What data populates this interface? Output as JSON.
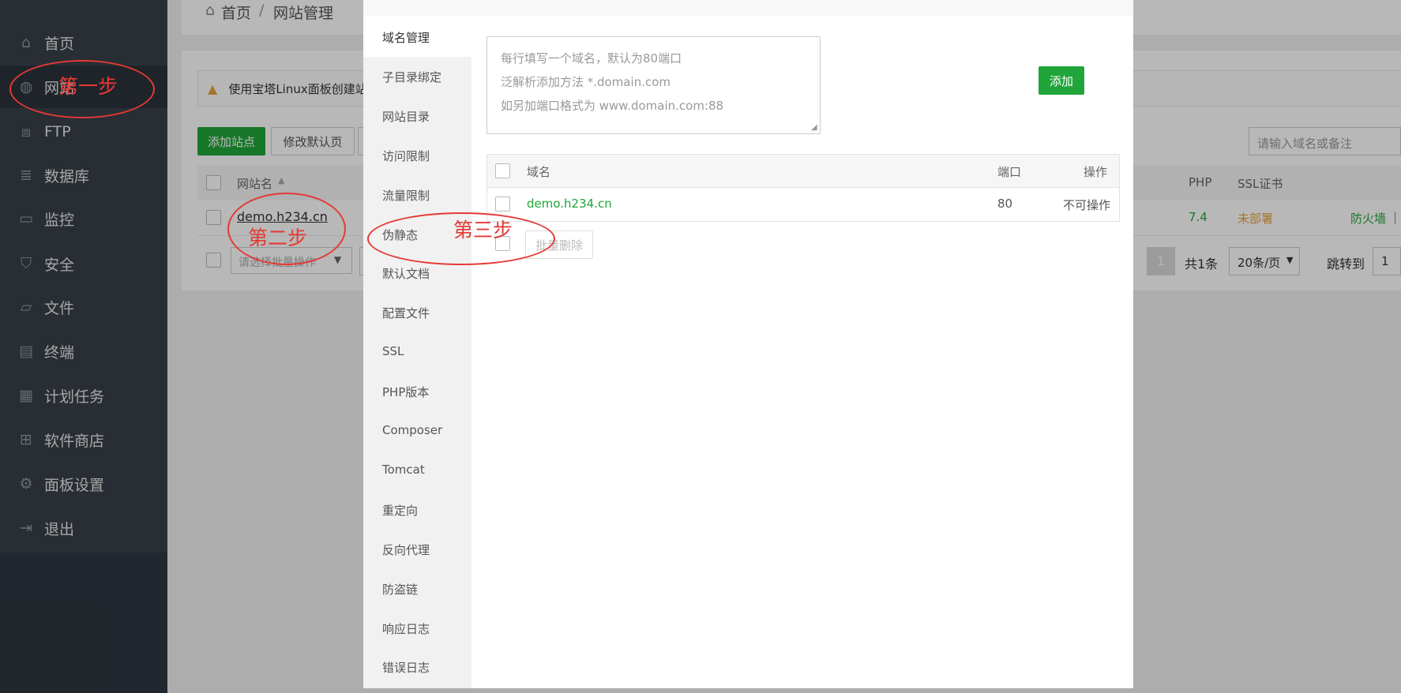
{
  "sidebar": {
    "items": [
      {
        "label": "首页",
        "icon": "home-icon"
      },
      {
        "label": "网站",
        "icon": "globe-icon"
      },
      {
        "label": "FTP",
        "icon": "ftp-icon"
      },
      {
        "label": "数据库",
        "icon": "database-icon"
      },
      {
        "label": "监控",
        "icon": "monitor-icon"
      },
      {
        "label": "安全",
        "icon": "shield-icon"
      },
      {
        "label": "文件",
        "icon": "folder-icon"
      },
      {
        "label": "终端",
        "icon": "terminal-icon"
      },
      {
        "label": "计划任务",
        "icon": "calendar-icon"
      },
      {
        "label": "软件商店",
        "icon": "grid-icon"
      },
      {
        "label": "面板设置",
        "icon": "gear-icon"
      },
      {
        "label": "退出",
        "icon": "logout-icon"
      }
    ]
  },
  "breadcrumb": {
    "home": "首页",
    "sep": "/",
    "current": "网站管理"
  },
  "alert": {
    "text": "使用宝塔Linux面板创建站"
  },
  "toolbar": {
    "add_site": "添加站点",
    "edit_default": "修改默认页"
  },
  "search": {
    "placeholder": "请输入域名或备注"
  },
  "site_table": {
    "headers": {
      "name": "网站名",
      "php": "PHP",
      "ssl": "SSL证书"
    },
    "row": {
      "name": "demo.h234.cn",
      "php": "7.4",
      "ssl": "未部署",
      "firewall": "防火墙",
      "sep": "|"
    }
  },
  "batch": {
    "placeholder": "请选择批量操作"
  },
  "pagination": {
    "page": "1",
    "total": "共1条",
    "per_page": "20条/页",
    "jump": "跳转到",
    "jump_value": "1"
  },
  "modal": {
    "nav": [
      "域名管理",
      "子目录绑定",
      "网站目录",
      "访问限制",
      "流量限制",
      "伪静态",
      "默认文档",
      "配置文件",
      "SSL",
      "PHP版本",
      "Composer",
      "Tomcat",
      "重定向",
      "反向代理",
      "防盗链",
      "响应日志",
      "错误日志"
    ],
    "textarea_lines": [
      "每行填写一个域名，默认为80端口",
      "泛解析添加方法 *.domain.com",
      "如另加端口格式为 www.domain.com:88"
    ],
    "add_button": "添加",
    "table": {
      "headers": {
        "domain": "域名",
        "port": "端口",
        "action": "操作"
      },
      "row": {
        "domain": "demo.h234.cn",
        "port": "80",
        "action": "不可操作"
      }
    },
    "batch_delete": "批量删除"
  },
  "annotations": {
    "step1": "第一步",
    "step2": "第二步",
    "step3": "第三步"
  },
  "colors": {
    "sidebar": "#384049",
    "green": "#20a53a",
    "orange": "#e6a23c",
    "annotation": "#e53935"
  }
}
